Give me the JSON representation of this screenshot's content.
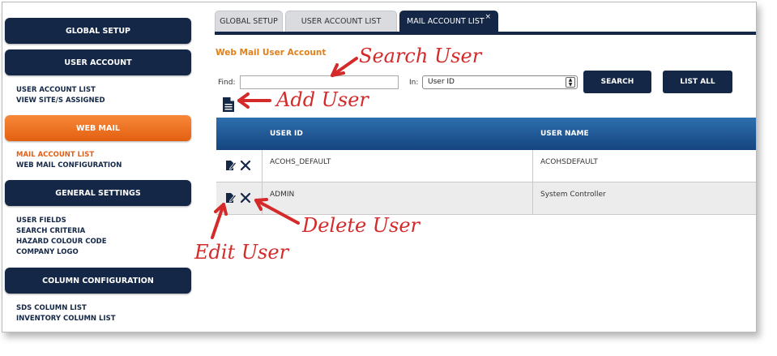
{
  "sidebar": {
    "global_setup": "GLOBAL SETUP",
    "user_account": "USER ACCOUNT",
    "user_account_list": "USER ACCOUNT LIST",
    "view_sites_assigned": "VIEW SITE/S ASSIGNED",
    "web_mail": "WEB MAIL",
    "mail_account_list": "MAIL ACCOUNT LIST",
    "web_mail_configuration": "WEB MAIL CONFIGURATION",
    "general_settings": "GENERAL SETTINGS",
    "user_fields": "USER FIELDS",
    "search_criteria": "SEARCH CRITERIA",
    "hazard_colour_code": "HAZARD COLOUR CODE",
    "company_logo": "COMPANY LOGO",
    "column_configuration": "COLUMN CONFIGURATION",
    "sds_column_list": "SDS COLUMN LIST",
    "inventory_column_list": "INVENTORY COLUMN LIST"
  },
  "tabs": [
    {
      "label": "GLOBAL SETUP"
    },
    {
      "label": "USER ACCOUNT LIST"
    },
    {
      "label": "MAIL ACCOUNT LIST",
      "close": "×"
    }
  ],
  "main": {
    "heading": "Web Mail User Account",
    "find_label": "Find:",
    "find_value": "",
    "in_label": "In:",
    "in_selected": "User ID",
    "search_button": "SEARCH",
    "list_all_button": "LIST ALL"
  },
  "table": {
    "headers": [
      "USER ID",
      "USER NAME"
    ],
    "rows": [
      {
        "user_id": "ACOHS_DEFAULT",
        "user_name": "ACOHSDEFAULT"
      },
      {
        "user_id": "ADMIN",
        "user_name": "System Controller"
      }
    ]
  },
  "annotations": {
    "search_user": "Search User",
    "add_user": "Add User",
    "delete_user": "Delete User",
    "edit_user": "Edit User"
  },
  "icons": {
    "add": "document-add-icon",
    "edit": "edit-icon",
    "delete": "delete-icon"
  },
  "colors": {
    "navy": "#142746",
    "orange": "#e0601a",
    "header_blue": "#2d6fae",
    "annotation_red": "#d42a2a"
  }
}
